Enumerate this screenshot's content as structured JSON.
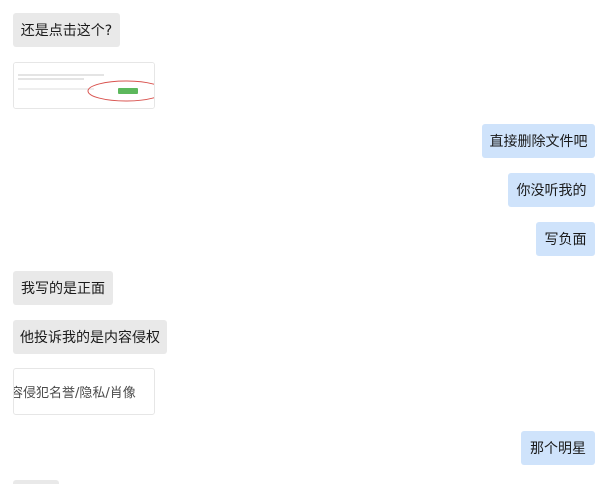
{
  "messages": {
    "m1": "还是点击这个?",
    "m2": "直接删除文件吧",
    "m3": "你没听我的",
    "m4": "写负面",
    "m5": "我写的是正面",
    "m6": "他投诉我的是内容侵权",
    "m7": "容侵犯名誉/隐私/肖像",
    "m8": "那个明星"
  },
  "colors": {
    "incoming_bubble": "#e9e9e9",
    "outgoing_bubble": "#cfe3fb",
    "button_green": "#5cb85c",
    "highlight_red": "#d9534f"
  }
}
